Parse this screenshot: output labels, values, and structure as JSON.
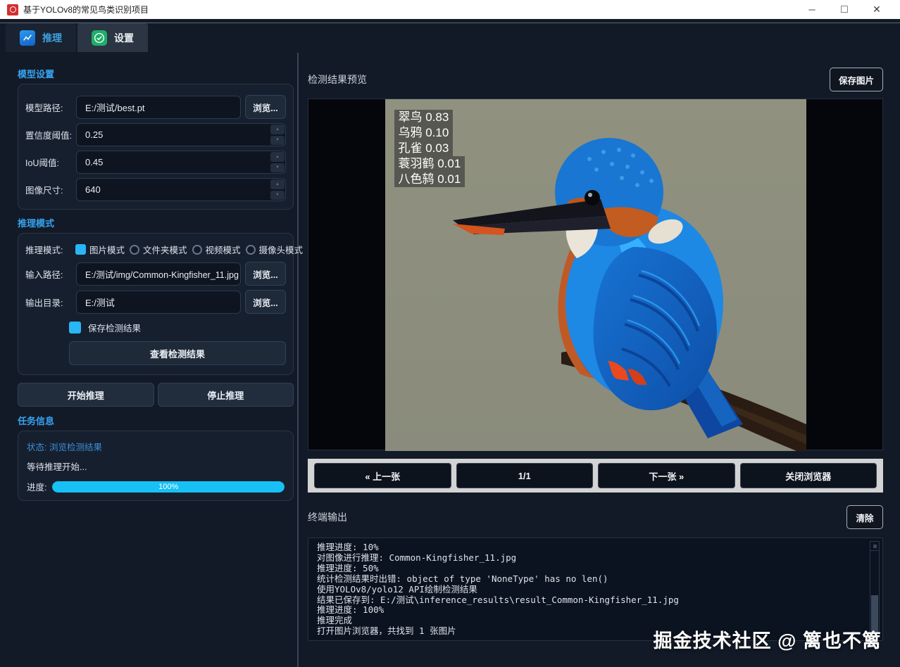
{
  "window": {
    "title": "基于YOLOv8的常见鸟类识别项目",
    "controls": {
      "minimize": "─",
      "maximize": "□",
      "close": "✕"
    }
  },
  "tabs": [
    {
      "label": "推理",
      "icon": "chart-line-icon",
      "active": true
    },
    {
      "label": "设置",
      "icon": "check-circle-icon",
      "active": false
    }
  ],
  "model_settings": {
    "header": "模型设置",
    "model_path_label": "模型路径:",
    "model_path_value": "E:/测试/best.pt",
    "browse_label": "浏览...",
    "confidence_label": "置信度阈值:",
    "confidence_value": "0.25",
    "iou_label": "IoU阈值:",
    "iou_value": "0.45",
    "imgsize_label": "图像尺寸:",
    "imgsize_value": "640"
  },
  "inference_mode": {
    "header": "推理模式",
    "mode_label": "推理模式:",
    "modes": [
      {
        "label": "图片模式",
        "selected": true
      },
      {
        "label": "文件夹模式",
        "selected": false
      },
      {
        "label": "视频模式",
        "selected": false
      },
      {
        "label": "摄像头模式",
        "selected": false
      }
    ],
    "input_path_label": "输入路径:",
    "input_path_value": "E:/测试/img/Common-Kingfisher_11.jpg",
    "output_dir_label": "输出目录:",
    "output_dir_value": "E:/测试",
    "browse_label": "浏览...",
    "save_results_label": "保存检测结果",
    "save_results_checked": true,
    "view_results_label": "查看检测结果"
  },
  "actions": {
    "start_label": "开始推理",
    "stop_label": "停止推理"
  },
  "task_info": {
    "header": "任务信息",
    "status_text": "状态: 浏览检测结果",
    "wait_text": "等待推理开始...",
    "progress_label": "进度:",
    "progress_value": "100%",
    "progress_percent": 100
  },
  "preview": {
    "header": "检测结果预览",
    "save_image_label": "保存图片",
    "detections": [
      {
        "label": "翠鸟 0.83"
      },
      {
        "label": "乌鸦 0.10"
      },
      {
        "label": "孔雀 0.03"
      },
      {
        "label": "蓑羽鹤 0.01"
      },
      {
        "label": "八色鸫 0.01"
      }
    ],
    "nav": {
      "prev": "« 上一张",
      "page": "1/1",
      "next": "下一张 »",
      "close": "关闭浏览器"
    }
  },
  "terminal": {
    "header": "终端输出",
    "clear_label": "清除",
    "lines": [
      "推理进度: 10%",
      "对图像进行推理: Common-Kingfisher_11.jpg",
      "推理进度: 50%",
      "统计检测结果时出错: object of type 'NoneType' has no len()",
      "使用YOLOv8/yolo12 API绘制检测结果",
      "结果已保存到: E:/测试\\inference_results\\result_Common-Kingfisher_11.jpg",
      "推理进度: 100%",
      "推理完成",
      "打开图片浏览器，共找到 1 张图片"
    ]
  },
  "watermark": "掘金技术社区 @ 篱也不篱",
  "colors": {
    "accent_blue": "#36a3f0",
    "checkbox_blue": "#29b6f6",
    "progress_cyan": "#17c1f5",
    "tab_icon_blue": "#1976d2",
    "tab_icon_green": "#1fae6a",
    "titlebar_icon_red": "#d32f2f",
    "nav_strip_gray": "#d3d3d3"
  }
}
